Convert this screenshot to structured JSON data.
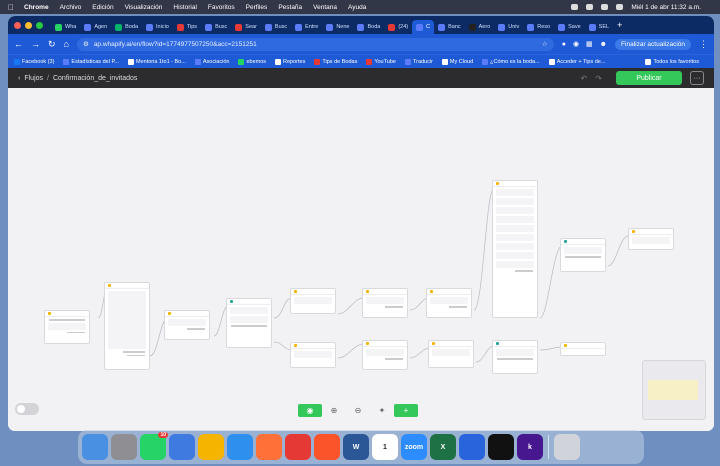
{
  "menubar": {
    "app": "Chrome",
    "items": [
      "Archivo",
      "Edición",
      "Visualización",
      "Historial",
      "Favoritos",
      "Perfiles",
      "Pestaña",
      "Ventana",
      "Ayuda"
    ],
    "clock": "Miél 1 de abr 11:32 a.m."
  },
  "tabs": [
    {
      "label": "Wha",
      "color": "#25d366"
    },
    {
      "label": "Agen",
      "color": "#5b7cfa"
    },
    {
      "label": "Boda",
      "color": "#00b16a"
    },
    {
      "label": "Inicio",
      "color": "#5b7cfa"
    },
    {
      "label": "Tips",
      "color": "#e53935"
    },
    {
      "label": "Busc",
      "color": "#5b7cfa"
    },
    {
      "label": "Sear",
      "color": "#e53935"
    },
    {
      "label": "Busc",
      "color": "#5b7cfa"
    },
    {
      "label": "Entre",
      "color": "#5b7cfa"
    },
    {
      "label": "Nene",
      "color": "#5b7cfa"
    },
    {
      "label": "Boda",
      "color": "#5b7cfa"
    },
    {
      "label": "(24)",
      "color": "#e53935"
    },
    {
      "label": "C",
      "color": "#5b7cfa",
      "active": true
    },
    {
      "label": "Banc",
      "color": "#5b7cfa"
    },
    {
      "label": "Aero",
      "color": "#222222"
    },
    {
      "label": "Univ",
      "color": "#5b7cfa"
    },
    {
      "label": "Reso",
      "color": "#5b7cfa"
    },
    {
      "label": "Save",
      "color": "#5b7cfa"
    },
    {
      "label": "SEL",
      "color": "#5b7cfa"
    }
  ],
  "address": {
    "url": "ap.whapify.ai/en/flow?id=1774977507250&acc=2151251",
    "update_label": "Finalizar actualización"
  },
  "bookmarks": [
    {
      "label": "Facebook (3)",
      "color": "#1877f2"
    },
    {
      "label": "Estadísticas del P...",
      "color": "#5b7cfa"
    },
    {
      "label": "Mentoria 1to1 - Bo...",
      "color": "#ffffff"
    },
    {
      "label": "Asociación",
      "color": "#5b7cfa"
    },
    {
      "label": "ebemos",
      "color": "#25d366"
    },
    {
      "label": "Reportes",
      "color": "#ffffff"
    },
    {
      "label": "Tips de Bodas",
      "color": "#e53935"
    },
    {
      "label": "YouTube",
      "color": "#e53935"
    },
    {
      "label": "Traducir",
      "color": "#5b7cfa"
    },
    {
      "label": "My Cloud",
      "color": "#ffffff"
    },
    {
      "label": "¿Cómo es la boda...",
      "color": "#5b7cfa"
    },
    {
      "label": "Acceder + Tips de...",
      "color": "#ffffff"
    },
    {
      "label": "Todos los favoritos",
      "color": "#ffffff"
    }
  ],
  "appbar": {
    "breadcrumb_root": "Flujos",
    "flow_name": "Confirmación_de_invitados",
    "publish_label": "Publicar",
    "more_label": "···"
  },
  "zoom_controls": {
    "plus_label": "+"
  },
  "dock": [
    {
      "name": "finder",
      "color": "#4a90e2",
      "label": ""
    },
    {
      "name": "launchpad",
      "color": "#8e8e93",
      "label": ""
    },
    {
      "name": "whatsapp",
      "color": "#25d366",
      "label": "",
      "badge": "10"
    },
    {
      "name": "flow-app",
      "color": "#3f7ae0",
      "label": ""
    },
    {
      "name": "chrome",
      "color": "#f4b400",
      "label": ""
    },
    {
      "name": "safari",
      "color": "#2f8fef",
      "label": ""
    },
    {
      "name": "firefox",
      "color": "#ff7139",
      "label": ""
    },
    {
      "name": "opera",
      "color": "#e53935",
      "label": ""
    },
    {
      "name": "brave",
      "color": "#fb542b",
      "label": ""
    },
    {
      "name": "word",
      "color": "#2b5797",
      "label": "W"
    },
    {
      "name": "calendar",
      "color": "#ffffff",
      "label": "1"
    },
    {
      "name": "zoom",
      "color": "#2d8cff",
      "label": "zoom"
    },
    {
      "name": "excel",
      "color": "#1e7145",
      "label": "X"
    },
    {
      "name": "screen",
      "color": "#2a64dd",
      "label": ""
    },
    {
      "name": "capcut",
      "color": "#111111",
      "label": ""
    },
    {
      "name": "kahoot",
      "color": "#46178f",
      "label": "k"
    },
    {
      "name": "trash",
      "color": "#d0d4da",
      "label": ""
    }
  ]
}
